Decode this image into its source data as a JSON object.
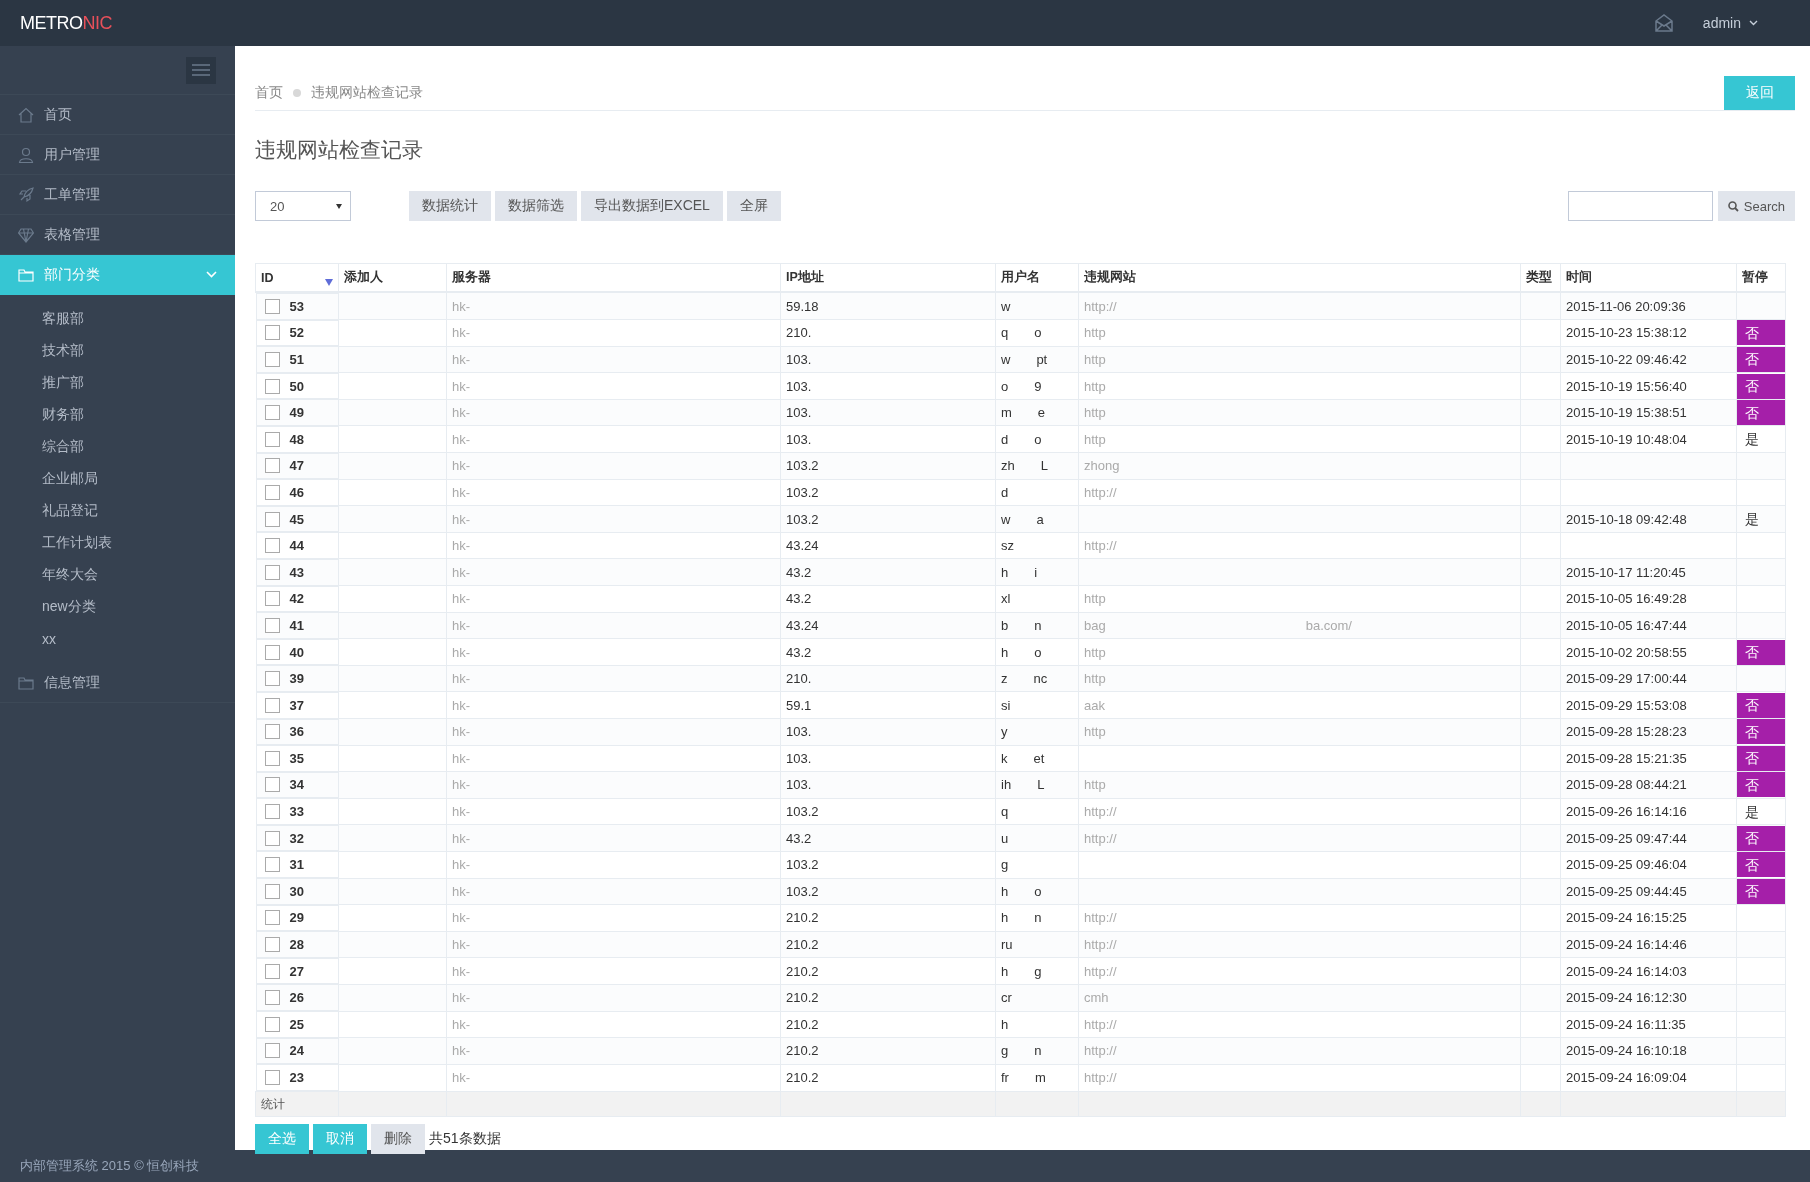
{
  "brand": {
    "main": "METRO",
    "accent": "NIC"
  },
  "user_menu": {
    "name": "admin"
  },
  "sidebar": {
    "items": [
      {
        "label": "首页",
        "selected": false
      },
      {
        "label": "用户管理",
        "selected": false
      },
      {
        "label": "工单管理",
        "selected": false
      },
      {
        "label": "表格管理",
        "selected": false
      },
      {
        "label": "部门分类",
        "selected": true,
        "expanded": true,
        "children": [
          {
            "label": "客服部"
          },
          {
            "label": "技术部"
          },
          {
            "label": "推广部"
          },
          {
            "label": "财务部"
          },
          {
            "label": "综合部"
          },
          {
            "label": "企业邮局"
          },
          {
            "label": "礼品登记"
          },
          {
            "label": "工作计划表"
          },
          {
            "label": "年终大会"
          },
          {
            "label": "new分类"
          },
          {
            "label": "xx"
          }
        ]
      },
      {
        "label": "信息管理",
        "selected": false
      }
    ]
  },
  "breadcrumb": [
    "首页",
    "违规网站检查记录"
  ],
  "back_button": "返回",
  "page_title": "违规网站检查记录",
  "page_size": "20",
  "toolbar_buttons": [
    "数据统计",
    "数据筛选",
    "导出数据到EXCEL",
    "全屏"
  ],
  "search_button": "Search",
  "table": {
    "columns": [
      "ID",
      "添加人",
      "服务器",
      "IP地址",
      "用户名",
      "违规网站",
      "类型",
      "时间",
      "暂停"
    ],
    "rows": [
      {
        "id": "53",
        "checked": false,
        "server": "hk-",
        "ip": "59.18",
        "user": [
          "w"
        ],
        "site": [
          "http://"
        ],
        "time": "2015-11-06 20:09:36",
        "pause": null
      },
      {
        "id": "52",
        "checked": false,
        "server": "hk-",
        "ip": "210.",
        "user": [
          "q",
          "o"
        ],
        "site": [
          "http"
        ],
        "time": "2015-10-23 15:38:12",
        "pause": {
          "label": "否",
          "highlighted": true
        }
      },
      {
        "id": "51",
        "checked": false,
        "server": "hk-",
        "ip": "103.",
        "user": [
          "w",
          "pt"
        ],
        "site": [
          "http"
        ],
        "time": "2015-10-22 09:46:42",
        "pause": {
          "label": "否",
          "highlighted": true
        }
      },
      {
        "id": "50",
        "checked": false,
        "server": "hk-",
        "ip": "103.",
        "user": [
          "o",
          "9"
        ],
        "site": [
          "http"
        ],
        "time": "2015-10-19 15:56:40",
        "pause": {
          "label": "否",
          "highlighted": true
        }
      },
      {
        "id": "49",
        "checked": false,
        "server": "hk-",
        "ip": "103.",
        "user": [
          "m",
          "e"
        ],
        "site": [
          "http"
        ],
        "time": "2015-10-19 15:38:51",
        "pause": {
          "label": "否",
          "highlighted": true
        }
      },
      {
        "id": "48",
        "checked": false,
        "server": "hk-",
        "ip": "103.",
        "user": [
          "d",
          "o"
        ],
        "site": [
          "http"
        ],
        "time": "2015-10-19 10:48:04",
        "pause": {
          "label": "是",
          "highlighted": false
        }
      },
      {
        "id": "47",
        "checked": false,
        "server": "hk-",
        "ip": "103.2",
        "user": [
          "zh",
          "L"
        ],
        "site": [
          "zhong"
        ],
        "time": "",
        "pause": null
      },
      {
        "id": "46",
        "checked": false,
        "server": "hk-",
        "ip": "103.2",
        "user": [
          "d"
        ],
        "site": [
          "http://"
        ],
        "time": "",
        "pause": null
      },
      {
        "id": "45",
        "checked": false,
        "server": "hk-",
        "ip": "103.2",
        "user": [
          "w",
          "a"
        ],
        "site": [],
        "time": "2015-10-18 09:42:48",
        "pause": {
          "label": "是",
          "highlighted": false
        }
      },
      {
        "id": "44",
        "checked": false,
        "server": "hk-",
        "ip": "43.24",
        "user": [
          "sz"
        ],
        "site": [
          "http://"
        ],
        "time": "",
        "pause": null
      },
      {
        "id": "43",
        "checked": false,
        "server": "hk-",
        "ip": "43.2",
        "user": [
          "h",
          "i"
        ],
        "site": [],
        "time": "2015-10-17 11:20:45",
        "pause": null
      },
      {
        "id": "42",
        "checked": false,
        "server": "hk-",
        "ip": "43.2",
        "user": [
          "xl"
        ],
        "site": [
          "http"
        ],
        "time": "2015-10-05 16:49:28",
        "pause": null
      },
      {
        "id": "41",
        "checked": false,
        "server": "hk-",
        "ip": "43.24",
        "user": [
          "b",
          "n"
        ],
        "site": [
          "bag",
          "ba.com/"
        ],
        "time": "2015-10-05 16:47:44",
        "pause": null
      },
      {
        "id": "40",
        "checked": false,
        "server": "hk-",
        "ip": "43.2",
        "user": [
          "h",
          "o"
        ],
        "site": [
          "http"
        ],
        "time": "2015-10-02 20:58:55",
        "pause": {
          "label": "否",
          "highlighted": true
        }
      },
      {
        "id": "39",
        "checked": false,
        "server": "hk-",
        "ip": "210.",
        "user": [
          "z",
          "nc"
        ],
        "site": [
          "http"
        ],
        "time": "2015-09-29 17:00:44",
        "pause": null
      },
      {
        "id": "37",
        "checked": false,
        "server": "hk-",
        "ip": "59.1",
        "user": [
          "si"
        ],
        "site": [
          "aak"
        ],
        "time": "2015-09-29 15:53:08",
        "pause": {
          "label": "否",
          "highlighted": true
        }
      },
      {
        "id": "36",
        "checked": false,
        "server": "hk-",
        "ip": "103.",
        "user": [
          "y"
        ],
        "site": [
          "http"
        ],
        "time": "2015-09-28 15:28:23",
        "pause": {
          "label": "否",
          "highlighted": true
        }
      },
      {
        "id": "35",
        "checked": false,
        "server": "hk-",
        "ip": "103.",
        "user": [
          "k",
          "et"
        ],
        "site": [],
        "time": "2015-09-28 15:21:35",
        "pause": {
          "label": "否",
          "highlighted": true
        }
      },
      {
        "id": "34",
        "checked": false,
        "server": "hk-",
        "ip": "103.",
        "user": [
          "ih",
          "L"
        ],
        "site": [
          "http"
        ],
        "time": "2015-09-28 08:44:21",
        "pause": {
          "label": "否",
          "highlighted": true
        }
      },
      {
        "id": "33",
        "checked": false,
        "server": "hk-",
        "ip": "103.2",
        "user": [
          "q"
        ],
        "site": [
          "http://"
        ],
        "time": "2015-09-26 16:14:16",
        "pause": {
          "label": "是",
          "highlighted": false
        }
      },
      {
        "id": "32",
        "checked": false,
        "server": "hk-",
        "ip": "43.2",
        "user": [
          "u"
        ],
        "site": [
          "http://"
        ],
        "time": "2015-09-25 09:47:44",
        "pause": {
          "label": "否",
          "highlighted": true
        }
      },
      {
        "id": "31",
        "checked": false,
        "server": "hk-",
        "ip": "103.2",
        "user": [
          "g"
        ],
        "site": [],
        "time": "2015-09-25 09:46:04",
        "pause": {
          "label": "否",
          "highlighted": true
        }
      },
      {
        "id": "30",
        "checked": false,
        "server": "hk-",
        "ip": "103.2",
        "user": [
          "h",
          "o"
        ],
        "site": [],
        "time": "2015-09-25 09:44:45",
        "pause": {
          "label": "否",
          "highlighted": true
        }
      },
      {
        "id": "29",
        "checked": false,
        "server": "hk-",
        "ip": "210.2",
        "user": [
          "h",
          "n"
        ],
        "site": [
          "http://"
        ],
        "time": "2015-09-24 16:15:25",
        "pause": null
      },
      {
        "id": "28",
        "checked": false,
        "server": "hk-",
        "ip": "210.2",
        "user": [
          "ru"
        ],
        "site": [
          "http://"
        ],
        "time": "2015-09-24 16:14:46",
        "pause": null
      },
      {
        "id": "27",
        "checked": false,
        "server": "hk-",
        "ip": "210.2",
        "user": [
          "h",
          "g"
        ],
        "site": [
          "http://"
        ],
        "time": "2015-09-24 16:14:03",
        "pause": null
      },
      {
        "id": "26",
        "checked": false,
        "server": "hk-",
        "ip": "210.2",
        "user": [
          "cr"
        ],
        "site": [
          "cmh"
        ],
        "time": "2015-09-24 16:12:30",
        "pause": null
      },
      {
        "id": "25",
        "checked": false,
        "server": "hk-",
        "ip": "210.2",
        "user": [
          "h"
        ],
        "site": [
          "http://"
        ],
        "time": "2015-09-24 16:11:35",
        "pause": null
      },
      {
        "id": "24",
        "checked": false,
        "server": "hk-",
        "ip": "210.2",
        "user": [
          "g",
          "n"
        ],
        "site": [
          "http://"
        ],
        "time": "2015-09-24 16:10:18",
        "pause": null
      },
      {
        "id": "23",
        "checked": false,
        "server": "hk-",
        "ip": "210.2",
        "user": [
          "fr",
          "m"
        ],
        "site": [
          "http://"
        ],
        "time": "2015-09-24 16:09:04",
        "pause": null
      }
    ],
    "total_label": "统计"
  },
  "bulk_buttons": [
    {
      "label": "全选",
      "kind": "primary"
    },
    {
      "label": "取消",
      "kind": "primary"
    },
    {
      "label": "删除",
      "kind": "default"
    }
  ],
  "record_count": "共51条数据",
  "footer": "内部管理系统 2015 © 恒创科技"
}
